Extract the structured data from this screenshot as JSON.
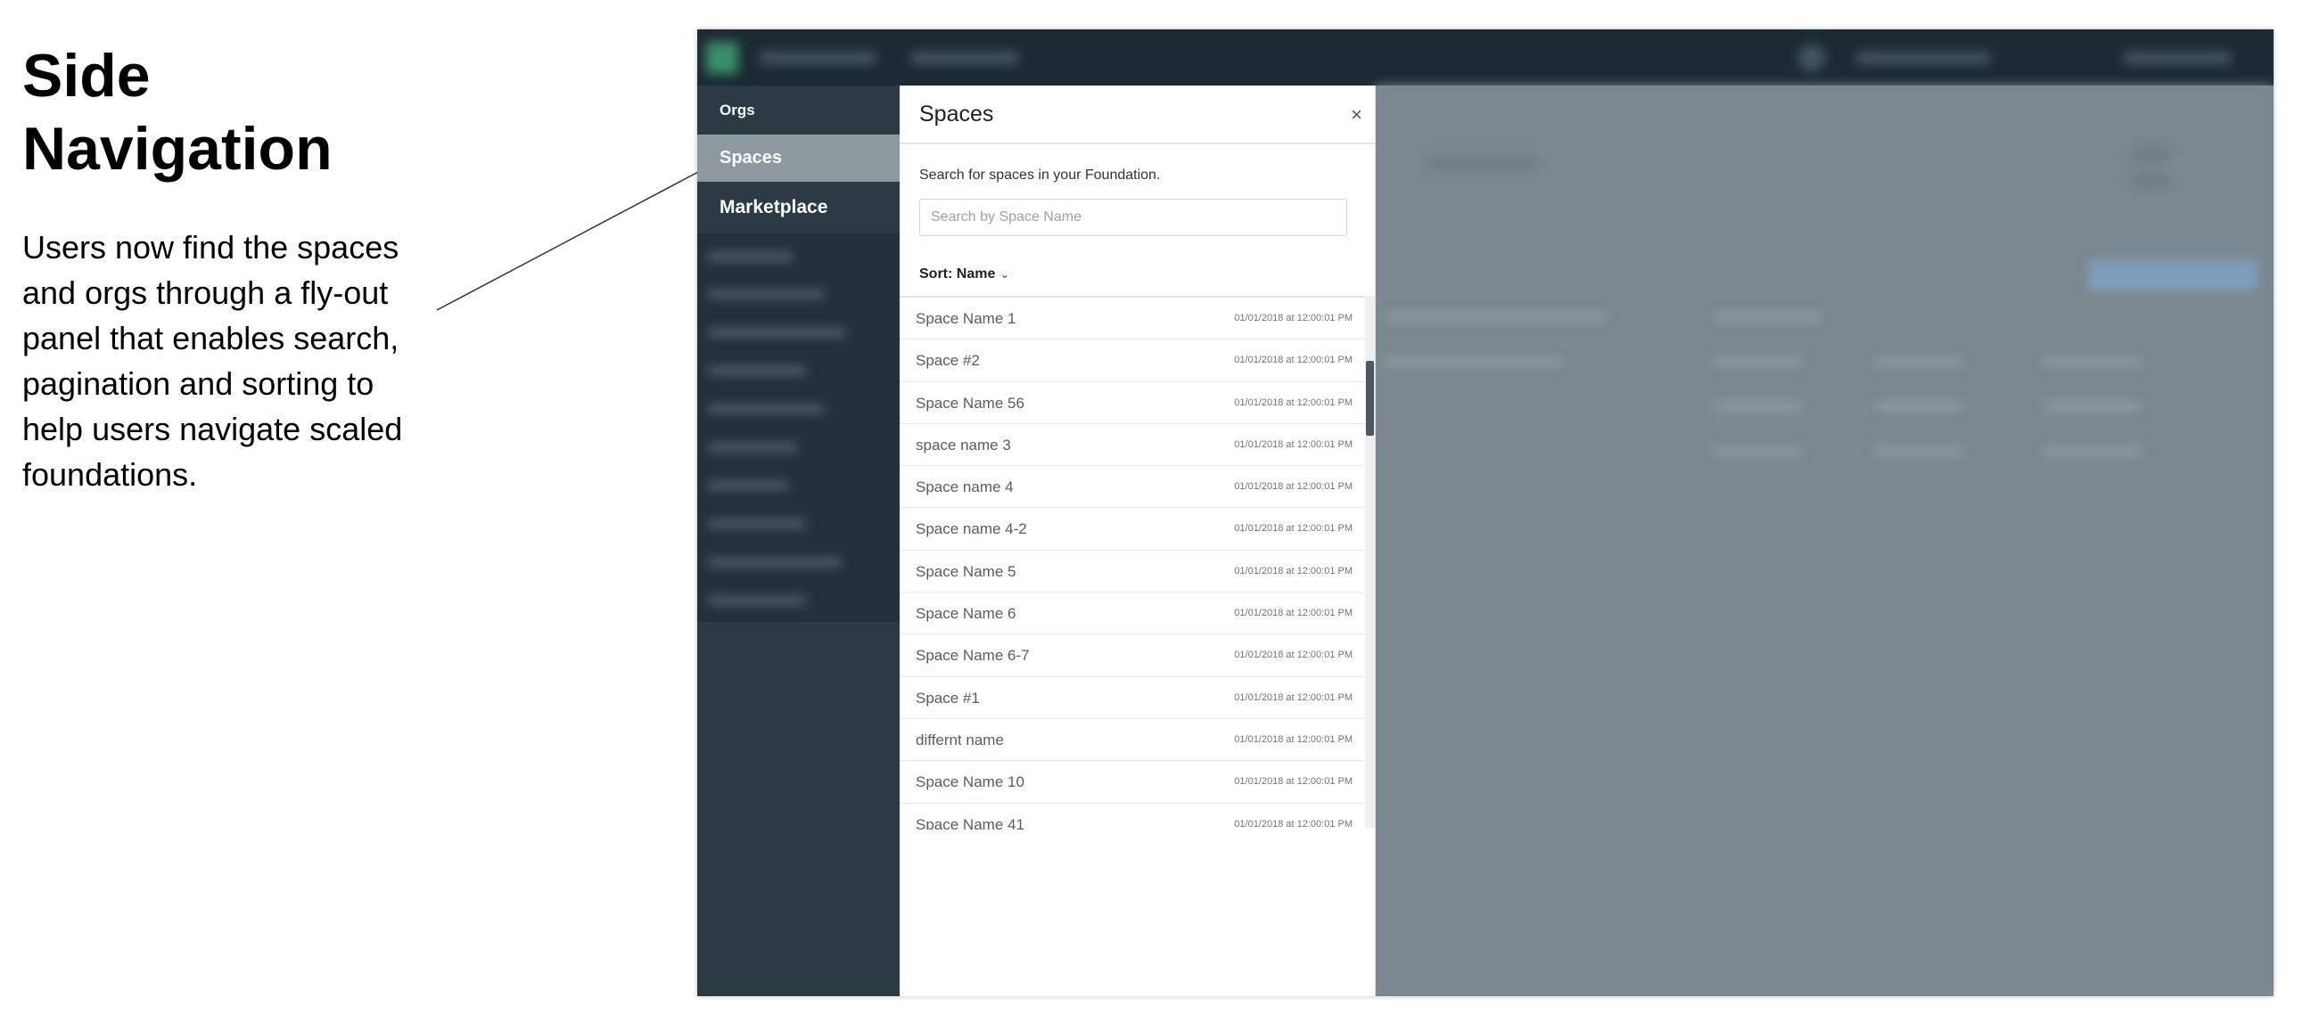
{
  "annotation": {
    "title_line1": "Side",
    "title_line2": "Navigation",
    "body": "Users now find the spaces and orgs through a fly-out panel that enables search, pagination and sorting to help users navigate scaled foundations."
  },
  "sidebar": {
    "orgs_label": "Orgs",
    "spaces_label": "Spaces",
    "marketplace_label": "Marketplace"
  },
  "flyout": {
    "title": "Spaces",
    "close_glyph": "×",
    "description": "Search for spaces in your Foundation.",
    "search_placeholder": "Search by Space Name",
    "sort_label": "Sort: Name",
    "sort_chevron": "⌄",
    "rows": [
      {
        "name": "Space Name 1",
        "date": "01/01/2018 at 12:00:01 PM"
      },
      {
        "name": "Space #2",
        "date": "01/01/2018 at 12:00:01 PM"
      },
      {
        "name": "Space Name 56",
        "date": "01/01/2018 at 12:00:01 PM"
      },
      {
        "name": "space name 3",
        "date": "01/01/2018 at 12:00:01 PM"
      },
      {
        "name": "Space name 4",
        "date": "01/01/2018 at 12:00:01 PM"
      },
      {
        "name": "Space name 4-2",
        "date": "01/01/2018 at 12:00:01 PM"
      },
      {
        "name": "Space Name 5",
        "date": "01/01/2018 at 12:00:01 PM"
      },
      {
        "name": "Space Name 6",
        "date": "01/01/2018 at 12:00:01 PM"
      },
      {
        "name": "Space Name 6-7",
        "date": "01/01/2018 at 12:00:01 PM"
      },
      {
        "name": "Space #1",
        "date": "01/01/2018 at 12:00:01 PM"
      },
      {
        "name": "differnt name",
        "date": "01/01/2018 at 12:00:01 PM"
      },
      {
        "name": "Space Name 10",
        "date": "01/01/2018 at 12:00:01 PM"
      },
      {
        "name": "Space Name 41",
        "date": "01/01/2018 at 12:00:01 PM"
      }
    ]
  },
  "colors": {
    "topbar": "#1d2a33",
    "sidebar": "#2b3a43",
    "sidebar_active": "#8d989f",
    "overlay": "#818b93"
  }
}
